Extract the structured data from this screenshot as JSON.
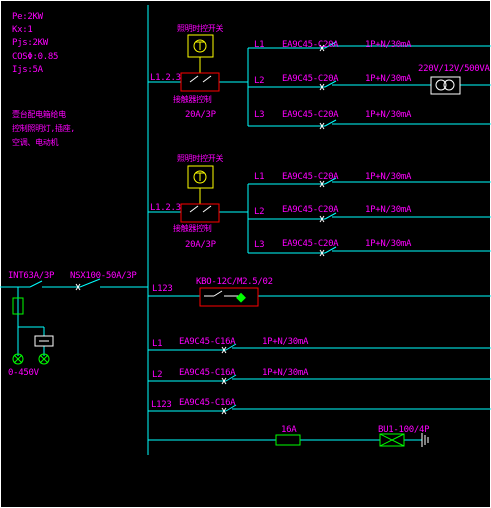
{
  "top_fragment": "······ ·····",
  "params": {
    "pe": "Pe:2KW",
    "kx": "Kx:1",
    "pjs": "Pjs:2KW",
    "cos": "COSΦ:0.85",
    "ijs": "Ijs:5A"
  },
  "note": {
    "line1": "壹台配电箱给电",
    "line2": "控制照明灯,插座,",
    "line3": "空调、电动机"
  },
  "panel1": {
    "relay_label": "照明时控开关",
    "contactor_label": "接触器控制",
    "bus_label": "L1.2.3",
    "breaker_rating": "20A/3P",
    "circuits": [
      {
        "phase": "L1",
        "breaker": "EA9C45-C20A",
        "rcd": "1P+N/30mA"
      },
      {
        "phase": "L2",
        "breaker": "EA9C45-C20A",
        "rcd": "1P+N/30mA"
      },
      {
        "phase": "L3",
        "breaker": "EA9C45-C20A",
        "rcd": "1P+N/30mA"
      }
    ],
    "transformer_label": "220V/12V/500VA"
  },
  "panel2": {
    "relay_label": "照明时控开关",
    "contactor_label": "接触器控制",
    "bus_label": "L1.2.3",
    "breaker_rating": "20A/3P",
    "circuits": [
      {
        "phase": "L1",
        "breaker": "EA9C45-C20A",
        "rcd": "1P+N/30mA"
      },
      {
        "phase": "L2",
        "breaker": "EA9C45-C20A",
        "rcd": "1P+N/30mA"
      },
      {
        "phase": "L3",
        "breaker": "EA9C45-C20A",
        "rcd": "1P+N/30mA"
      }
    ]
  },
  "incoming": {
    "isolator": "INT63A/3P",
    "main_breaker": "NSX100-50A/3P",
    "voltmeter": "0-450V"
  },
  "motor_circuit": {
    "bus_label": "L123",
    "starter": "KBO-12C/M2.5/02"
  },
  "outlets": [
    {
      "phase": "L1",
      "breaker": "EA9C45-C16A",
      "rcd": "1P+N/30mA"
    },
    {
      "phase": "L2",
      "breaker": "EA9C45-C16A",
      "rcd": "1P+N/30mA"
    },
    {
      "phase": "L123",
      "breaker": "EA9C45-C16A",
      "rcd": ""
    }
  ],
  "spd": {
    "fuse": "16A",
    "arrester": "BU1-100/4P"
  },
  "colors": {
    "background": "#000000",
    "wire": "#00ffff",
    "text_magenta": "#ff00ff",
    "text_green": "#00ff00",
    "component_red": "#ff0000",
    "relay_yellow": "#ffff00",
    "frame": "#ffffff"
  }
}
